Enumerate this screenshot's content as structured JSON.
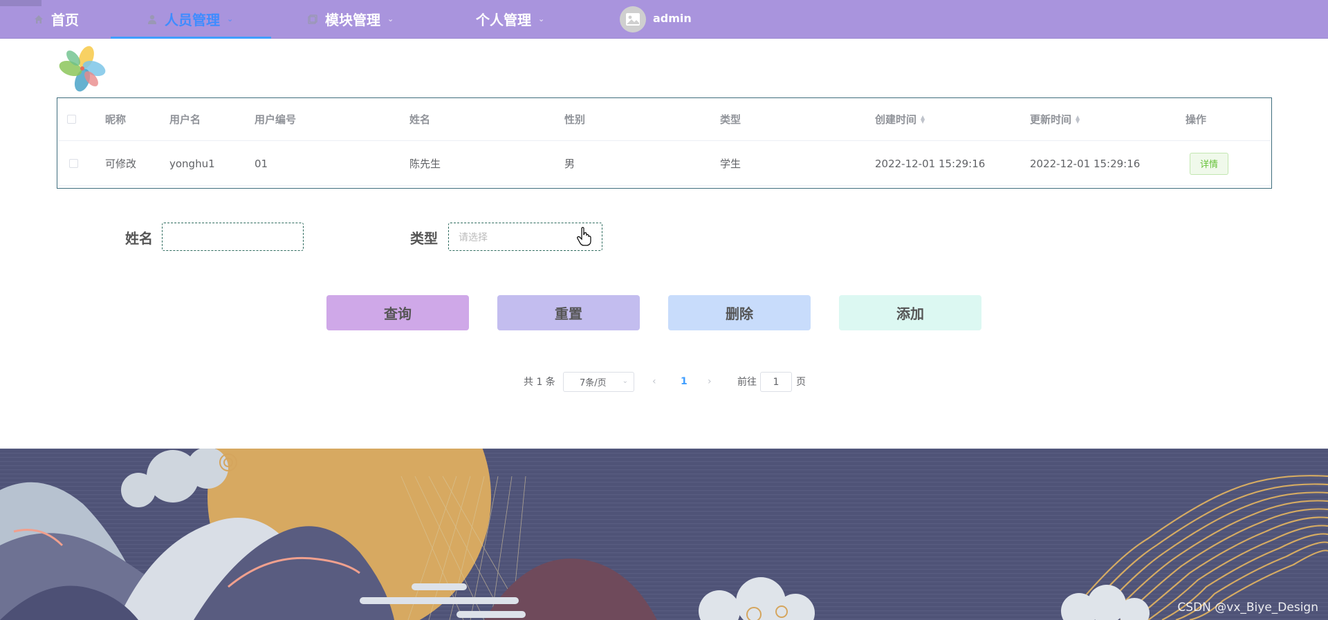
{
  "nav": {
    "items": [
      {
        "label": "首页",
        "icon": "home-icon"
      },
      {
        "label": "人员管理",
        "icon": "user-icon",
        "active": true
      },
      {
        "label": "模块管理",
        "icon": "module-icon"
      },
      {
        "label": "个人管理",
        "icon": ""
      }
    ],
    "user": "admin"
  },
  "table": {
    "headers": [
      "昵称",
      "用户名",
      "用户编号",
      "姓名",
      "性别",
      "类型",
      "创建时间",
      "更新时间",
      "操作"
    ],
    "rows": [
      {
        "cells": [
          "可修改",
          "yonghu1",
          "01",
          "陈先生",
          "男",
          "学生",
          "2022-12-01 15:29:16",
          "2022-12-01 15:29:16"
        ],
        "action": "详情"
      }
    ]
  },
  "search": {
    "name_label": "姓名",
    "name_value": "",
    "type_label": "类型",
    "type_placeholder": "请选择"
  },
  "buttons": {
    "query": "查询",
    "reset": "重置",
    "delete": "删除",
    "add": "添加"
  },
  "pagination": {
    "total": "共 1 条",
    "page_size": "7条/页",
    "current": "1",
    "goto_label": "前往",
    "goto_value": "1",
    "page_unit": "页"
  },
  "watermark": "CSDN @vx_Biye_Design",
  "colors": {
    "nav_bg": "#a994dd",
    "active": "#3f8cff",
    "query_btn": "#cfa8e8",
    "reset_btn": "#c3bdef",
    "delete_btn": "#c8dcfb",
    "add_btn": "#dcf8f2"
  }
}
